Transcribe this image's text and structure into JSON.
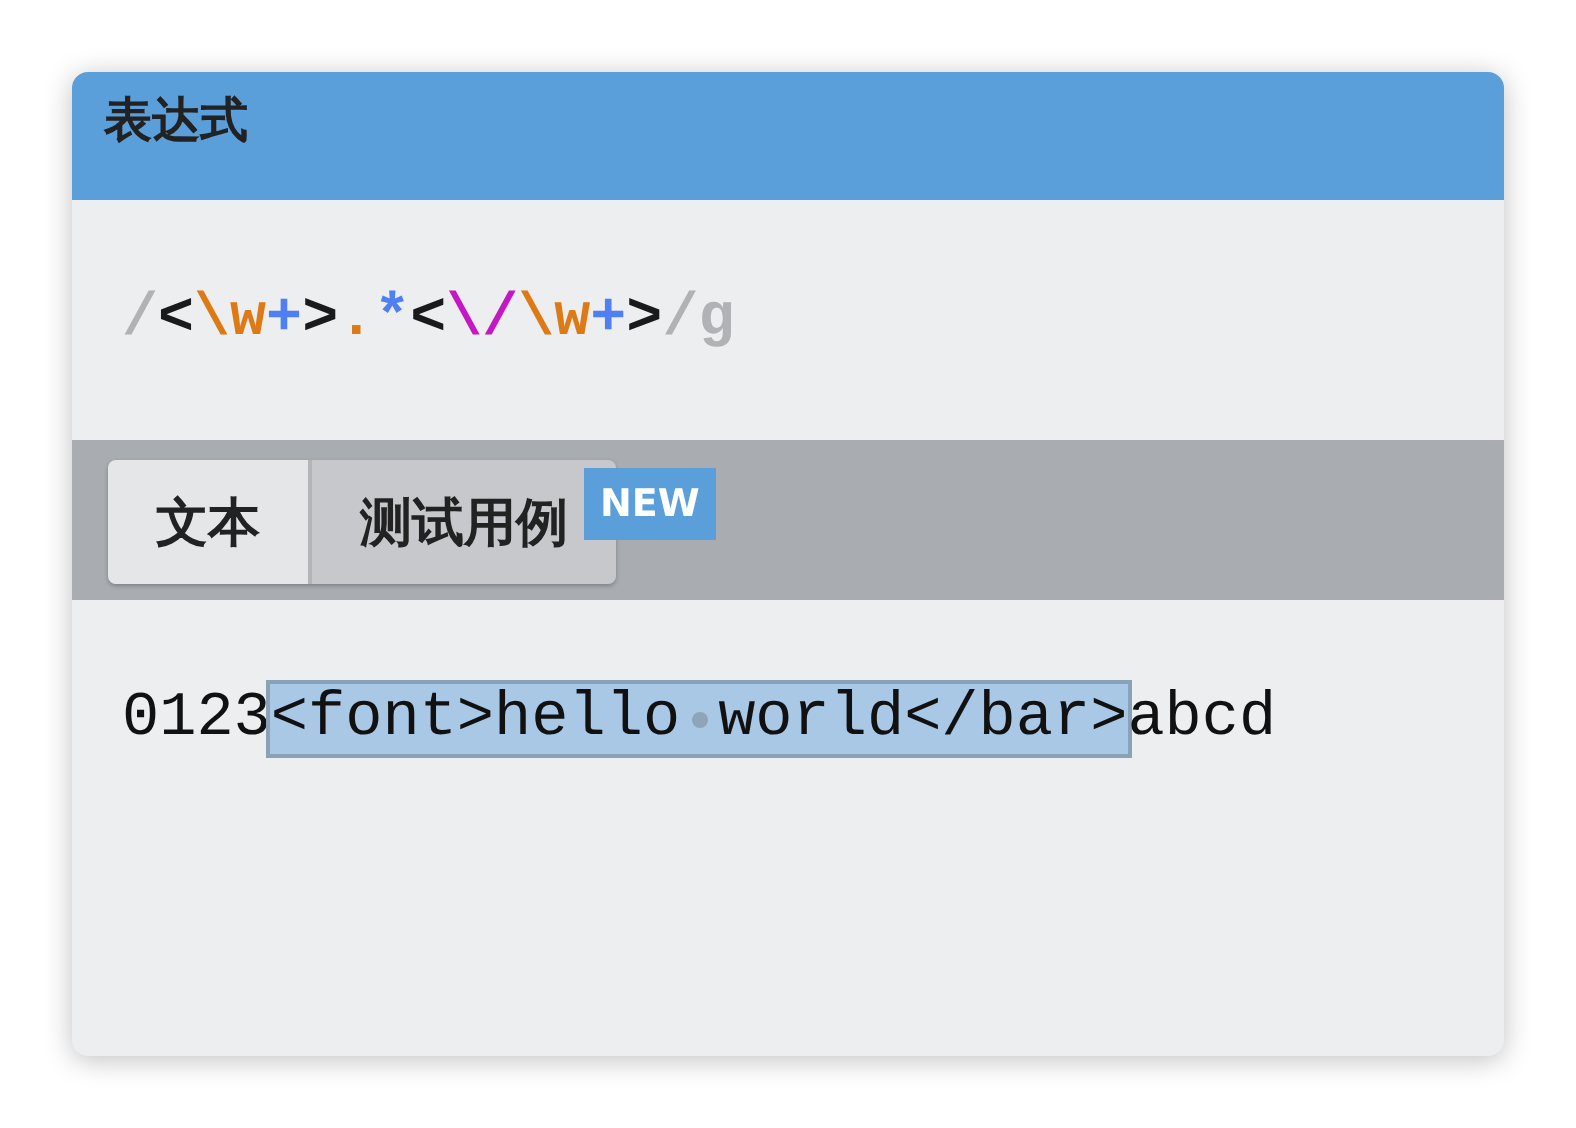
{
  "panel": {
    "title": "表达式"
  },
  "expression": {
    "tokens": [
      {
        "text": "/",
        "kind": "delimiter"
      },
      {
        "text": "<",
        "kind": "literal"
      },
      {
        "text": "\\w",
        "kind": "class"
      },
      {
        "text": "+",
        "kind": "quantifier"
      },
      {
        "text": ">",
        "kind": "literal"
      },
      {
        "text": ".",
        "kind": "class"
      },
      {
        "text": "*",
        "kind": "quantifier"
      },
      {
        "text": "<",
        "kind": "literal"
      },
      {
        "text": "\\/",
        "kind": "escape"
      },
      {
        "text": "\\w",
        "kind": "class"
      },
      {
        "text": "+",
        "kind": "quantifier"
      },
      {
        "text": ">",
        "kind": "literal"
      },
      {
        "text": "/g",
        "kind": "flags"
      }
    ]
  },
  "tabs": [
    {
      "label": "文本",
      "selected": true
    },
    {
      "label": "测试用例",
      "selected": false,
      "badge": "NEW"
    }
  ],
  "text": {
    "segments": [
      {
        "text": "0123",
        "matched": false
      },
      {
        "text": "<font>hello world</bar>",
        "matched": true
      },
      {
        "text": "abcd",
        "matched": false
      }
    ]
  }
}
